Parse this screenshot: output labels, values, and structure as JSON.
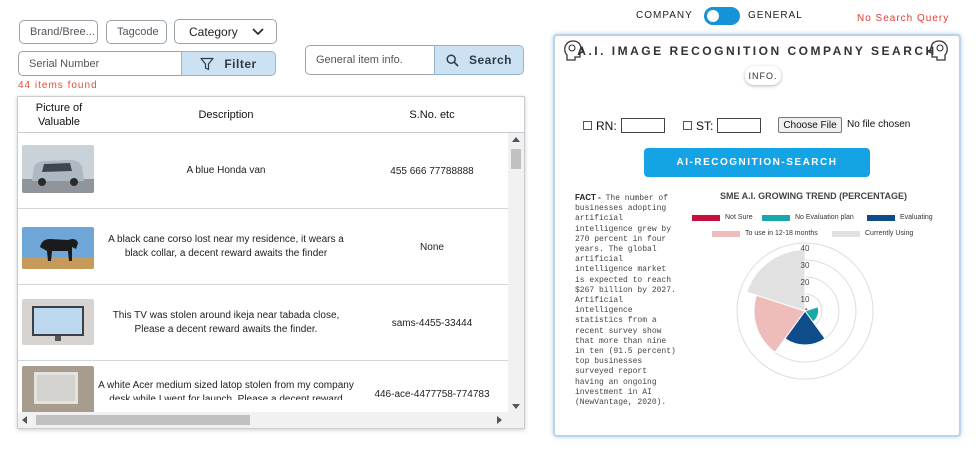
{
  "toolbar": {
    "brand_placeholder": "Brand/Bree...",
    "tagcode_placeholder": "Tagcode",
    "category_label": "Category",
    "serial_placeholder": "Serial Number",
    "filter_label": "Filter",
    "general_placeholder": "General item info.",
    "search_label": "Search"
  },
  "results": {
    "count_text": "44 items found",
    "columns": [
      "Picture of Valuable",
      "Description",
      "S.No. etc"
    ],
    "rows": [
      {
        "description": "A blue Honda van",
        "sno": "455 666 77788888",
        "image": "honda-van-photo"
      },
      {
        "description": "A black cane corso lost near my residence, it wears a black collar, a decent reward awaits the finder",
        "sno": "None",
        "image": "cane-corso-dog-photo"
      },
      {
        "description": "This TV was stolen around ikeja near tabada close, Please a decent reward awaits the finder.",
        "sno": "sams-4455-33444",
        "image": "tv-photo"
      },
      {
        "description": "A white Acer medium sized latop stolen from my company desk while I went for launch, Please a decent reward awaits the finder. Thank you",
        "sno": "446-ace-4477758-774783",
        "image": "laptop-photo"
      }
    ]
  },
  "mode_toggle": {
    "left_label": "COMPANY",
    "right_label": "GENERAL",
    "state": "general"
  },
  "no_search_query": "No Search Query",
  "ai_panel": {
    "title": "A.I. IMAGE RECOGNITION COMPANY SEARCH",
    "info_label": "INFO.",
    "rn_label": "RN:",
    "st_label": "ST:",
    "choose_file_label": "Choose File",
    "no_file_label": "No file chosen",
    "search_button": "AI-RECOGNITION-SEARCH",
    "fact_label": "FACT -",
    "fact_text": "The number of businesses adopting artificial intelligence grew by 270 percent in four years. The global artificial intelligence market is expected to reach $267 billion by 2027. Artificial intelligence statistics from a recent survey show that more than nine in ten (91.5 percent) top businesses surveyed report having an ongoing investment in AI (NewVantage, 2020).",
    "icons": [
      "brain-head-icon",
      "brain-head-icon"
    ]
  },
  "chart_data": {
    "type": "polarArea",
    "title": "SME A.I. GROWING TREND (PERCENTAGE)",
    "categories": [
      "Not Sure",
      "No Evaluation plan",
      "Evaluating",
      "To use in 12-18 months",
      "Currently Using"
    ],
    "values": [
      2,
      8,
      20,
      30,
      36
    ],
    "colors": [
      "#c8103e",
      "#17aaa9",
      "#0f4c8a",
      "#efbcbc",
      "#e1e1e1"
    ],
    "r_ticks": [
      10,
      20,
      30,
      40
    ],
    "rlim": [
      0,
      40
    ],
    "legend_position": "top"
  }
}
